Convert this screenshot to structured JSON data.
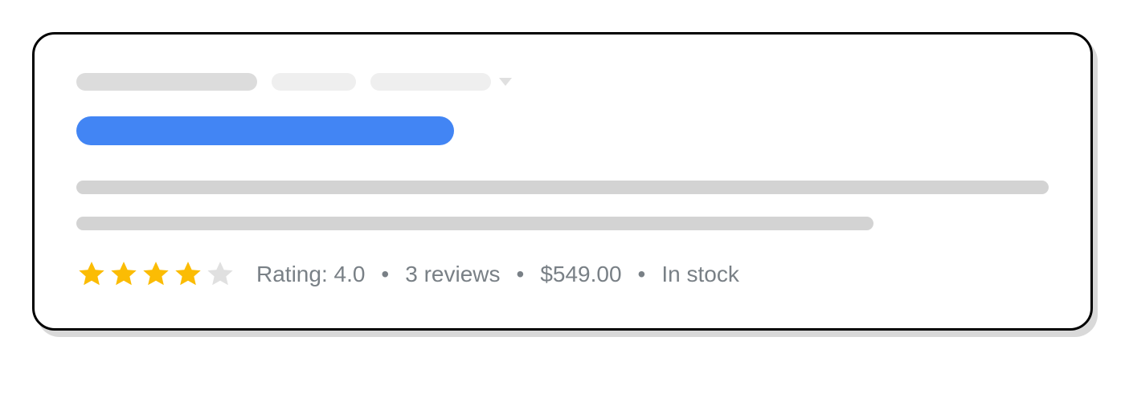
{
  "result": {
    "rating_label": "Rating: 4.0",
    "reviews_text": "3 reviews",
    "price": "$549.00",
    "stock_status": "In stock",
    "star_rating": 4,
    "star_max": 5
  },
  "separator": "•"
}
